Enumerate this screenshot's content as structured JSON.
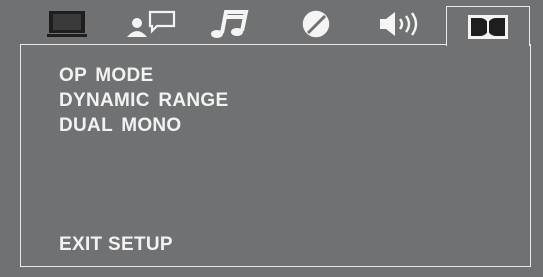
{
  "tabs": [
    {
      "icon": "tv-monitor-icon",
      "active": false
    },
    {
      "icon": "language-speech-icon",
      "active": false
    },
    {
      "icon": "music-note-icon",
      "active": false
    },
    {
      "icon": "video-adjust-icon",
      "active": false
    },
    {
      "icon": "speaker-icon",
      "active": false
    },
    {
      "icon": "dolby-digital-icon",
      "active": true
    }
  ],
  "menu": {
    "items": [
      {
        "label": "OP MODE"
      },
      {
        "label": "DYNAMIC RANGE"
      },
      {
        "label": "DUAL MONO"
      }
    ],
    "exit_label": "EXIT SETUP"
  },
  "colors": {
    "background": "#6f7172",
    "text": "#f2f2f2",
    "border": "#e9e9e9",
    "icon_dark": "#1e1e1e",
    "icon_light": "#f4f4f4"
  }
}
